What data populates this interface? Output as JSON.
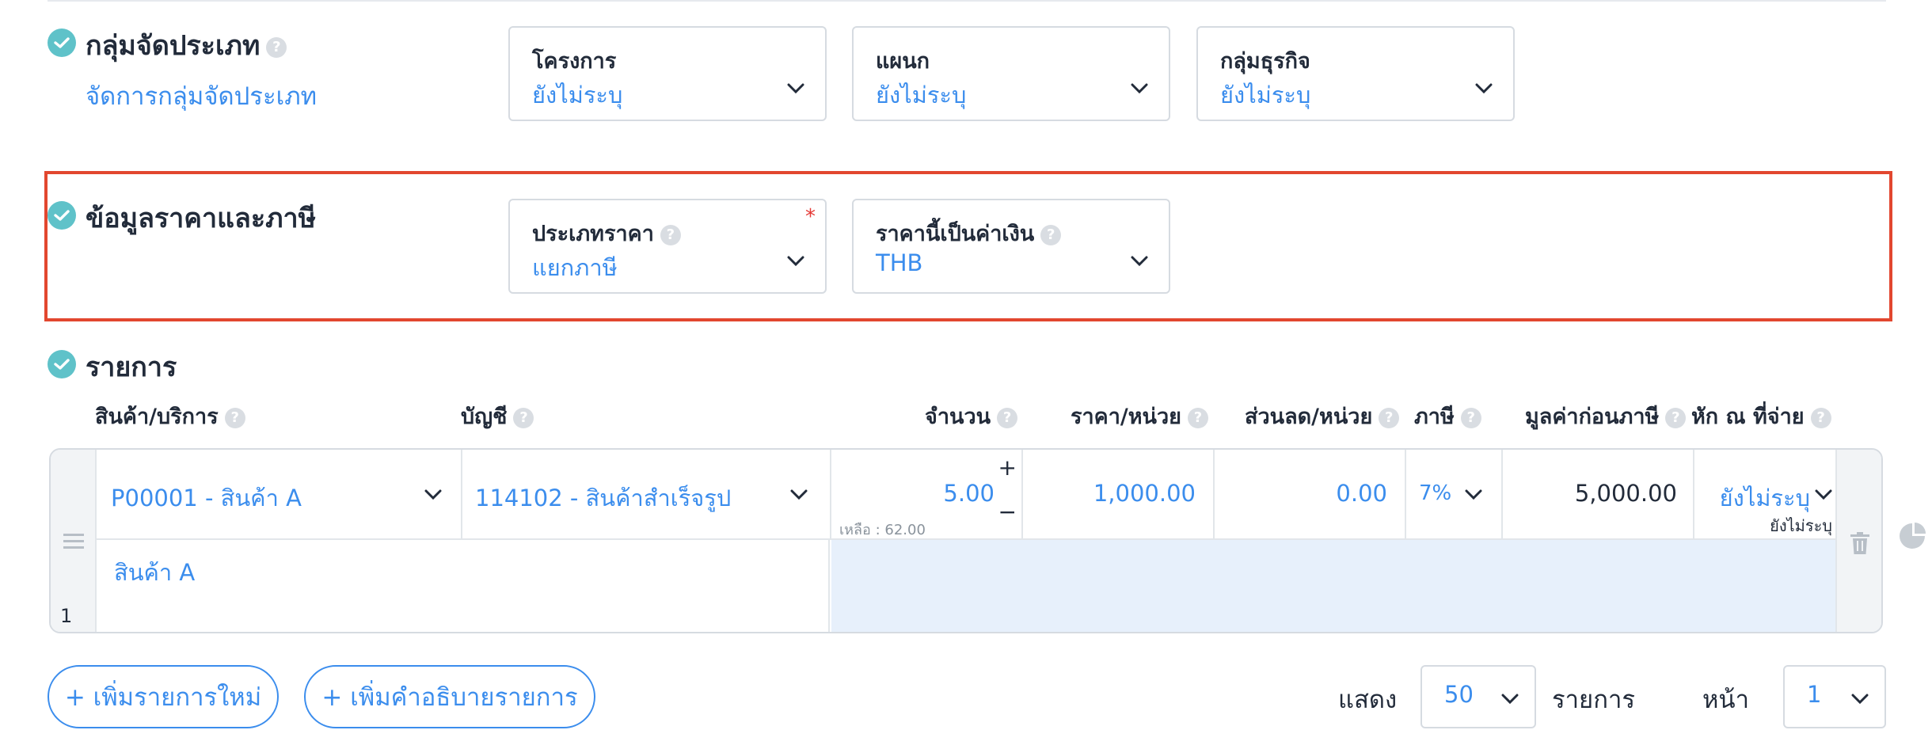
{
  "classification": {
    "title": "กลุ่มจัดประเภท",
    "manage_link": "จัดการกลุ่มจัดประเภท",
    "fields": [
      {
        "label": "โครงการ",
        "value": "ยังไม่ระบุ"
      },
      {
        "label": "แผนก",
        "value": "ยังไม่ระบุ"
      },
      {
        "label": "กลุ่มธุรกิจ",
        "value": "ยังไม่ระบุ"
      }
    ]
  },
  "pricing": {
    "title": "ข้อมูลราคาและภาษี",
    "price_type": {
      "label": "ประเภทราคา",
      "value": "แยกภาษี",
      "required_mark": "*"
    },
    "currency": {
      "label": "ราคานี้เป็นค่าเงิน",
      "value": "THB"
    }
  },
  "items": {
    "title": "รายการ",
    "columns": {
      "product": "สินค้า/บริการ",
      "account": "บัญชี",
      "quantity": "จำนวน",
      "unit_price": "ราคา/หน่วย",
      "discount": "ส่วนลด/หน่วย",
      "tax": "ภาษี",
      "pre_tax": "มูลค่าก่อนภาษี",
      "withholding": "หัก ณ ที่จ่าย"
    },
    "rows": [
      {
        "number": "1",
        "product": "P00001 - สินค้า A",
        "account": "114102 - สินค้าสำเร็จรูป",
        "quantity": "5.00",
        "remaining": "เหลือ : 62.00",
        "unit_price": "1,000.00",
        "discount": "0.00",
        "tax": "7%",
        "pre_tax": "5,000.00",
        "withholding": "ยังไม่ระบุ",
        "withholding_sub": "ยังไม่ระบุ",
        "description": "สินค้า A"
      }
    ],
    "qty_plus": "+",
    "qty_minus": "−"
  },
  "actions": {
    "add_item": "+ เพิ่มรายการใหม่",
    "add_description": "+ เพิ่มคำอธิบายรายการ"
  },
  "pagination": {
    "show_label": "แสดง",
    "per_page": "50",
    "items_label": "รายการ",
    "page_label": "หน้า",
    "page": "1"
  },
  "icons": {
    "check": "check-circle-icon",
    "help": "question-circle-icon",
    "chevron": "chevron-down-icon",
    "drag": "drag-handle-icon",
    "delete": "trash-icon",
    "chart": "pie-chart-icon"
  },
  "colors": {
    "accent": "#3b8ded",
    "check": "#5fc2c9",
    "highlight": "#e2472f",
    "required": "#e53935"
  }
}
